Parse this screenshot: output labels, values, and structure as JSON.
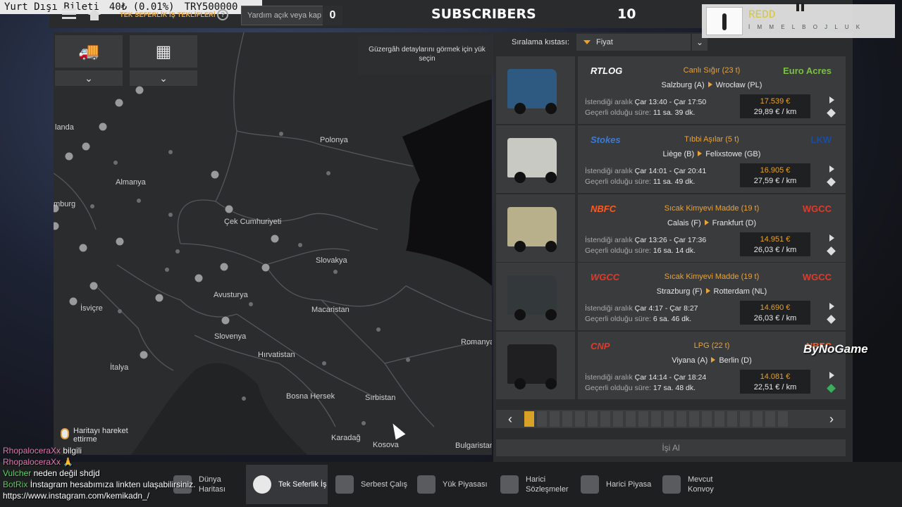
{
  "ticker": {
    "label": "Yurt Dışı Bileti",
    "value": "40₺ (0.01%)",
    "target": "TRY500000"
  },
  "header": {
    "breadcrumb": "TEK SEFERLİK İŞ TEKLİFLERİ",
    "search_placeholder": "Yardım açık veya kap",
    "search_count": "0",
    "subscribers_label": "SUBSCRIBERS",
    "subscribers_count": "10",
    "redd_name": "REDD",
    "redd_sub": "İ M M E L   B O J L U K"
  },
  "map": {
    "tooltip": "Güzergâh detaylarını görmek için yük seçin",
    "move_hint": "Haritayı hareket ettirme",
    "labels": [
      {
        "text": "Polonya"
      },
      {
        "text": "Almanya"
      },
      {
        "text": "Çek Cumhuriyeti"
      },
      {
        "text": "Slovakya"
      },
      {
        "text": "Avusturya"
      },
      {
        "text": "Macaristan"
      },
      {
        "text": "İsviçre"
      },
      {
        "text": "Slovenya"
      },
      {
        "text": "Hırvatistan"
      },
      {
        "text": "İtalya"
      },
      {
        "text": "Bosna Hersek"
      },
      {
        "text": "Sırbistan"
      },
      {
        "text": "Romanya"
      },
      {
        "text": "Karadağ"
      },
      {
        "text": "Kosova"
      },
      {
        "text": "Bulgaristan"
      },
      {
        "text": "landa"
      },
      {
        "text": "mburg"
      }
    ]
  },
  "sort": {
    "label": "Sıralama kıstası:",
    "value": "Fiyat"
  },
  "jobs": [
    {
      "company_left": "RTLOG",
      "company_right": "Euro Acres",
      "cargo": "Canlı Sığır (23 t)",
      "from": "Salzburg (A)",
      "to": "Wrocław (PL)",
      "window_label": "İstendiği aralık",
      "window": "Çar 13:40 - Çar 17:50",
      "valid_label": "Geçerli olduğu süre:",
      "valid": "11 sa. 39 dk.",
      "price": "17.539 €",
      "per_km": "29,89 € / km",
      "truck_color": "#2e5a82",
      "left_color": "#ffffff",
      "right_color": "#7ac043"
    },
    {
      "company_left": "Stokes",
      "company_right": "LKW",
      "cargo": "Tıbbi Aşılar (5 t)",
      "from": "Liège (B)",
      "to": "Felixstowe (GB)",
      "window_label": "İstendiği aralık",
      "window": "Çar 14:01 - Çar 20:41",
      "valid_label": "Geçerli olduğu süre:",
      "valid": "11 sa. 49 dk.",
      "price": "16.905 €",
      "per_km": "27,59 € / km",
      "truck_color": "#c9c9c3",
      "left_color": "#3a7bd5",
      "right_color": "#1b4d9e"
    },
    {
      "company_left": "NBFC",
      "company_right": "WGCC",
      "cargo": "Sıcak Kimyevi Madde (19 t)",
      "from": "Calais (F)",
      "to": "Frankfurt (D)",
      "window_label": "İstendiği aralık",
      "window": "Çar 13:26 - Çar 17:36",
      "valid_label": "Geçerli olduğu süre:",
      "valid": "16 sa. 14 dk.",
      "price": "14.951 €",
      "per_km": "26,03 € / km",
      "truck_color": "#b8b08a",
      "left_color": "#ff5a1f",
      "right_color": "#e03a2a"
    },
    {
      "company_left": "WGCC",
      "company_right": "WGCC",
      "cargo": "Sıcak Kimyevi Madde (19 t)",
      "from": "Strazburg (F)",
      "to": "Rotterdam (NL)",
      "window_label": "İstendiği aralık",
      "window": "Çar 4:17 - Çar 8:27",
      "valid_label": "Geçerli olduğu süre:",
      "valid": "6 sa. 46 dk.",
      "price": "14.690 €",
      "per_km": "26,03 € / km",
      "truck_color": "#33393a",
      "left_color": "#e03a2a",
      "right_color": "#e03a2a"
    },
    {
      "company_left": "CNP",
      "company_right": "NBFC",
      "cargo": "LPG (22 t)",
      "from": "Viyana (A)",
      "to": "Berlin (D)",
      "window_label": "İstendiği aralık",
      "window": "Çar 14:14 - Çar 18:24",
      "valid_label": "Geçerli olduğu süre:",
      "valid": "17 sa. 48 dk.",
      "price": "14.081 €",
      "per_km": "22,51 € / km",
      "truck_color": "#1f1f22",
      "left_color": "#e03a2a",
      "right_color": "#ff5a1f"
    }
  ],
  "pager": {
    "pages": 21,
    "active_page": 1
  },
  "take_job": "İşi Al",
  "watermark": "ByNoGame",
  "tabs": [
    {
      "label": "Dünya Haritası"
    },
    {
      "label": "Tek Seferlik İş"
    },
    {
      "label": "Serbest Çalış"
    },
    {
      "label": "Yük Piyasası"
    },
    {
      "label": "Harici Sözleşmeler"
    },
    {
      "label": "Harici Piyasa"
    },
    {
      "label": "Mevcut Konvoy"
    }
  ],
  "chat": [
    {
      "user": "RhopaloceraXx",
      "msg": "bilgili"
    },
    {
      "user": "RhopaloceraXx",
      "msg": "🙏"
    },
    {
      "user": "Vulcher",
      "msg": "neden değil shdjd"
    },
    {
      "user": "BotRix",
      "msg": "İnstagram hesabımıza linkten ulaşabilirsiniz."
    },
    {
      "user": "",
      "msg": "https://www.instagram.com/kemikadn_/"
    }
  ],
  "colors": {
    "accent": "#e8a33d",
    "price": "#f0a020",
    "panel": "#3a3b3d"
  }
}
